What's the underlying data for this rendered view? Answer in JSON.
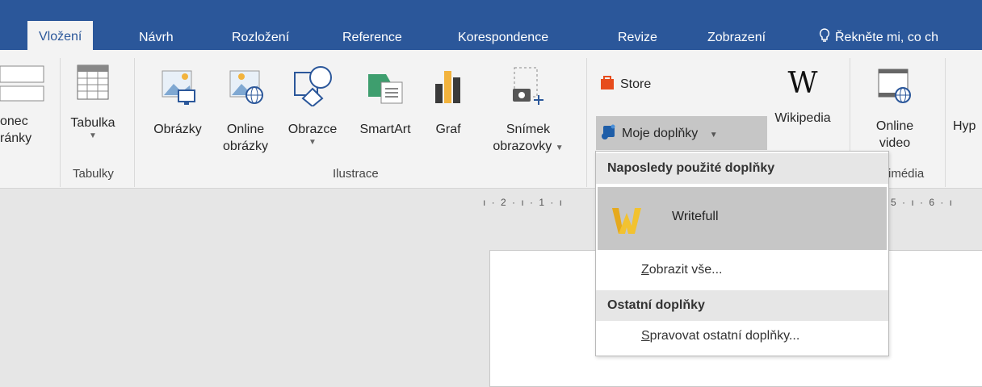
{
  "tabs": [
    {
      "label": "Vložení",
      "active": true
    },
    {
      "label": "Návrh"
    },
    {
      "label": "Rozložení"
    },
    {
      "label": "Reference"
    },
    {
      "label": "Korespondence"
    },
    {
      "label": "Revize"
    },
    {
      "label": "Zobrazení"
    }
  ],
  "tell_me": "Řekněte mi, co ch",
  "ribbon": {
    "konec_line1": "onec",
    "konec_line2": "ránky",
    "tabulka": "Tabulka",
    "tabulky_group": "Tabulky",
    "obrazky": "Obrázky",
    "online_obrazky_1": "Online",
    "online_obrazky_2": "obrázky",
    "obrazce": "Obrazce",
    "smartart": "SmartArt",
    "graf": "Graf",
    "snimek_1": "Snímek",
    "snimek_2": "obrazovky",
    "ilustrace_group": "Ilustrace",
    "store": "Store",
    "moje_doplnky": "Moje doplňky",
    "wikipedia": "Wikipedia",
    "online_video_1": "Online",
    "online_video_2": "video",
    "multimedia_group": "imédia",
    "hyp": "Hyp"
  },
  "ruler": {
    "left": "ı · 2 · ı · 1 · ı",
    "right": "5 · ı · 6 · ı"
  },
  "menu": {
    "recent_header": "Naposledy použité doplňky",
    "writefull": "Writefull",
    "show_all_accel": "Z",
    "show_all_rest": "obrazit vše...",
    "other_header": "Ostatní doplňky",
    "manage_accel": "S",
    "manage_rest": "pravovat ostatní doplňky..."
  },
  "colors": {
    "tab_bar": "#2b579a",
    "ribbon_bg": "#f3f3f3",
    "menu_highlight": "#c6c6c6"
  }
}
